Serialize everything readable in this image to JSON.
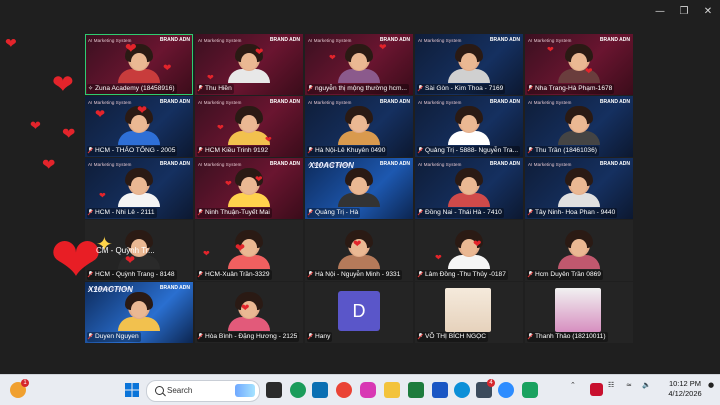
{
  "window": {
    "minimize_icon": "minimize-icon",
    "restore_icon": "restore-icon",
    "close_icon": "close-icon"
  },
  "tile_header": {
    "left": "AI Marketing System",
    "right": "BRAND ADN"
  },
  "brand_x10": "X10ACTION",
  "overflow": {
    "name": "CM - Quỳnh Tr..."
  },
  "tiles": [
    {
      "name": "Zuna Academy (18458916)",
      "pinned": true,
      "active": true
    },
    {
      "name": "Thu Hiền"
    },
    {
      "name": "nguyễn thị mộng thường hcm..."
    },
    {
      "name": "Sài Gòn - Kim Thoa - 7169"
    },
    {
      "name": "Nha Trang-Hà Phạm-1678"
    },
    {
      "name": "HCM - THẢO TỐNG - 2005"
    },
    {
      "name": "HCM Kiều Trinh 9192"
    },
    {
      "name": "Hà Nội-Lê Khuyên 0490"
    },
    {
      "name": "Quảng Trị - 5888- Nguyễn Tra..."
    },
    {
      "name": "Thu Trần (18461036)"
    },
    {
      "name": "HCM - Nhi Lê - 2111"
    },
    {
      "name": "Ninh Thuận-Tuyết Mai"
    },
    {
      "name": "Quảng Trị - Hà"
    },
    {
      "name": "Đồng Nai - Thái Hà - 7410"
    },
    {
      "name": "Tây Ninh- Hoa Phan - 9440"
    },
    {
      "name": "HCM - Quỳnh Trang - 8148"
    },
    {
      "name": "HCM-Xuân Trần-3329"
    },
    {
      "name": "Hà Nội - Nguyễn Minh - 9331"
    },
    {
      "name": "Lâm Đồng -Thu Thủy -0187"
    },
    {
      "name": "Hcm Duyên Trần 0869"
    },
    {
      "name": "Duyen Nguyen"
    },
    {
      "name": "Hòa Bình - Đặng Hương - 2125"
    },
    {
      "name": "Hany",
      "avatar": "D"
    },
    {
      "name": "VÕ THỊ BÍCH NGỌC"
    },
    {
      "name": "Thanh Thảo (18210011)"
    }
  ],
  "taskbar": {
    "search_placeholder": "Search",
    "notification_count": "1",
    "zoom_badge": "4",
    "time": "10:12 PM",
    "date": "4/12/2026"
  }
}
